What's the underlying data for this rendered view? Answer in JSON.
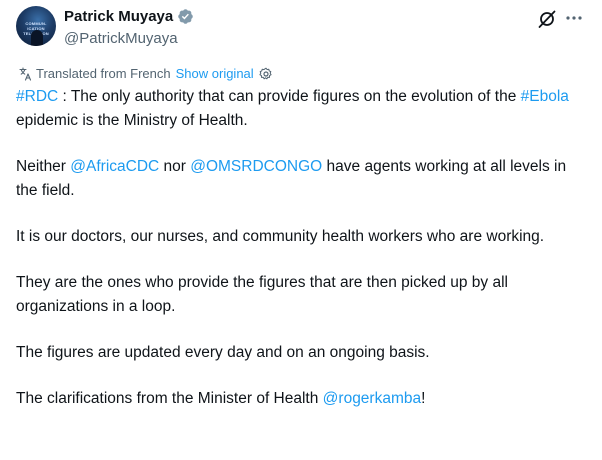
{
  "author": {
    "display_name": "Patrick Muyaya",
    "handle": "@PatrickMuyaya",
    "avatar_icon": "profile-photo",
    "verified_icon": "verified-badge-icon",
    "verified_color": "#829aab"
  },
  "header_actions": {
    "grok_icon": "grok-icon",
    "more_icon": "more-options-icon"
  },
  "translation": {
    "label": "Translated from French",
    "show_original": "Show original",
    "icon": "translate-icon",
    "settings_icon": "gear-icon"
  },
  "colors": {
    "text": "#0f1419",
    "secondary": "#536471",
    "link": "#1d9bf0"
  },
  "tweet": {
    "p1": {
      "hashtag1": "#RDC",
      "text1": " : The only authority that can provide figures on the evolution of the ",
      "hashtag2": "#Ebola",
      "text2": " epidemic is the Ministry of Health."
    },
    "p2": {
      "text1": "Neither ",
      "mention1": "@AfricaCDC",
      "text2": " nor ",
      "mention2": "@OMSRDCONGO",
      "text3": " have agents working at all levels in the field."
    },
    "p3": "It is our doctors, our nurses, and community health workers who are working.",
    "p4": "They are the ones who provide the figures that are then picked up by all organizations in a loop.",
    "p5": "The figures are updated every day and on an ongoing basis.",
    "p6": {
      "text1": "The clarifications from the Minister of Health ",
      "mention": "@rogerkamba",
      "text2": "!"
    }
  }
}
